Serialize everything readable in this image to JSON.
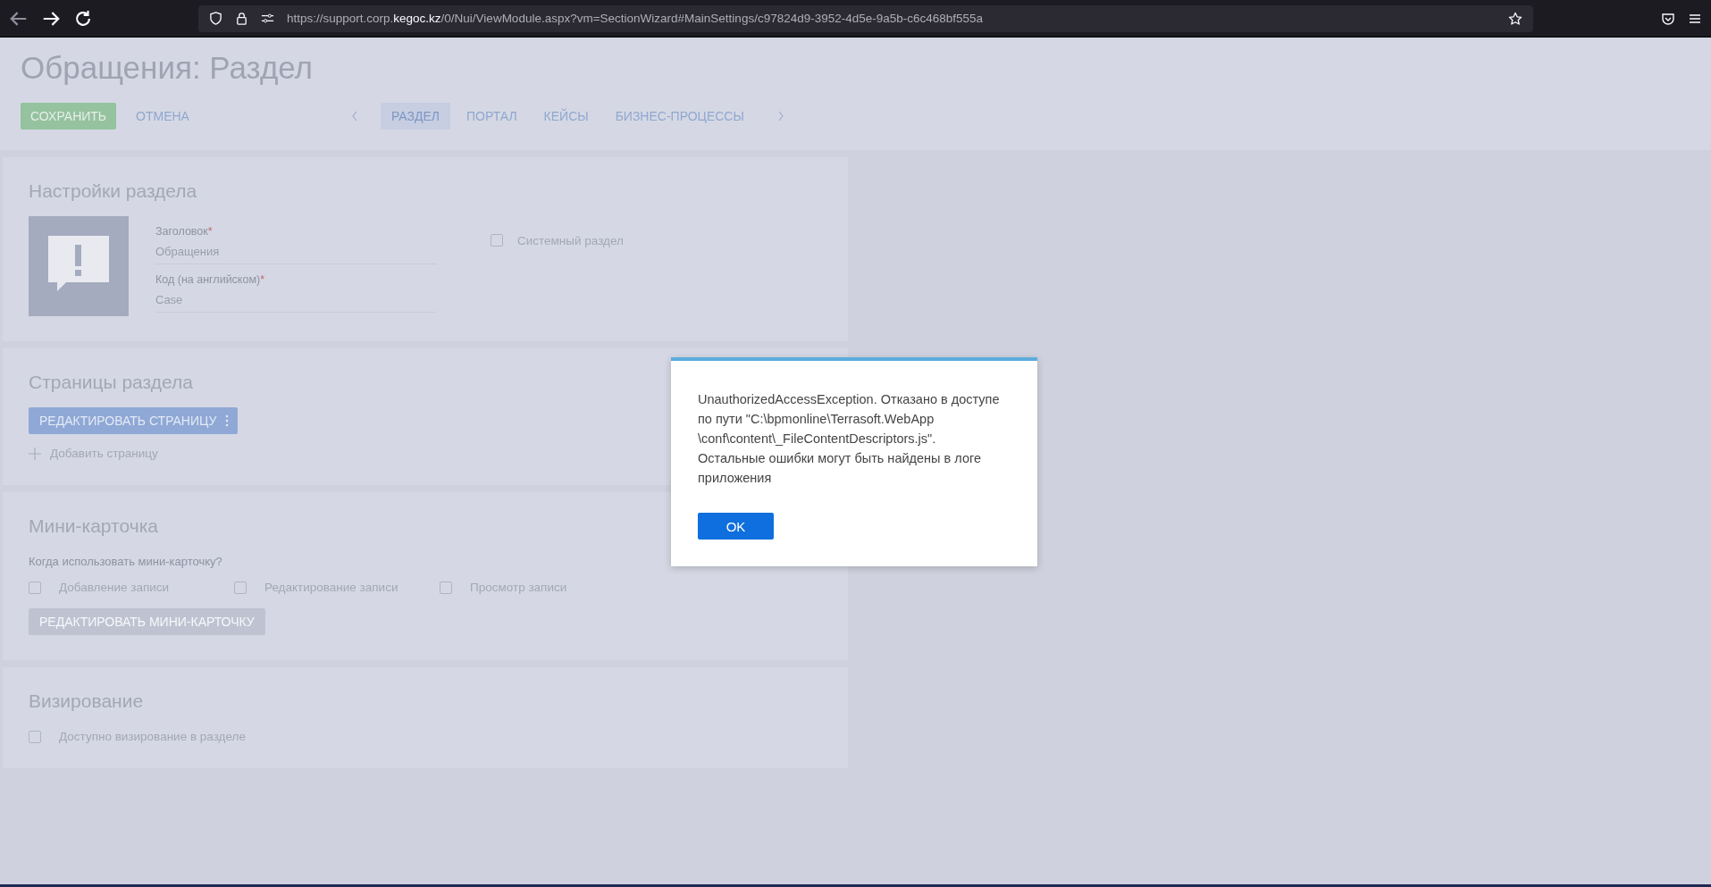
{
  "browser": {
    "url": "https://support.corp.**kegoc.kz**/0/Nui/ViewModule.aspx?vm=SectionWizard#MainSettings/c97824d9-3952-4d5e-9a5b-c6c468bf555a"
  },
  "page": {
    "title": "Обращения: Раздел",
    "actions": [
      {
        "label": "СОХРАНИТЬ",
        "kind": "primary"
      },
      {
        "label": "ОТМЕНА",
        "kind": "link"
      }
    ],
    "tabs": [
      {
        "label": "РАЗДЕЛ",
        "selected": true
      },
      {
        "label": "ПОРТАЛ",
        "selected": false
      },
      {
        "label": "КЕЙСЫ",
        "selected": false
      },
      {
        "label": "БИЗНЕС-ПРОЦЕССЫ",
        "selected": false
      }
    ]
  },
  "settings": {
    "title": "Настройки раздела",
    "fields": [
      {
        "label": "Заголовок",
        "required": true,
        "value": "Обращения"
      },
      {
        "label": "Код (на английском)",
        "required": true,
        "value": "Case"
      }
    ],
    "system_section": {
      "label": "Системный раздел",
      "checked": false
    }
  },
  "required_mark": "*",
  "pages": {
    "title": "Страницы раздела",
    "edit_button": "РЕДАКТИРОВАТЬ СТРАНИЦУ",
    "add_link": "Добавить страницу"
  },
  "mini_card": {
    "title": "Мини-карточка",
    "question": "Когда использовать мини-карточку?",
    "options": [
      {
        "label": "Добавление записи",
        "checked": false
      },
      {
        "label": "Редактирование записи",
        "checked": false
      },
      {
        "label": "Просмотр записи",
        "checked": false
      }
    ],
    "edit_button": {
      "label": "РЕДАКТИРОВАТЬ МИНИ-КАРТОЧКУ",
      "disabled": true
    }
  },
  "visa": {
    "title": "Визирование",
    "option": {
      "label": "Доступно визирование в разделе",
      "checked": false
    }
  },
  "dialog": {
    "message_lines": [
      "UnauthorizedAccessException. Отказано в доступе",
      "по пути \"C:\\bpmonline\\Terrasoft.WebApp",
      "\\conf\\content\\_FileContentDescriptors.js\".",
      "Остальные ошибки могут быть найдены в логе",
      "приложения"
    ],
    "button": "OK"
  }
}
